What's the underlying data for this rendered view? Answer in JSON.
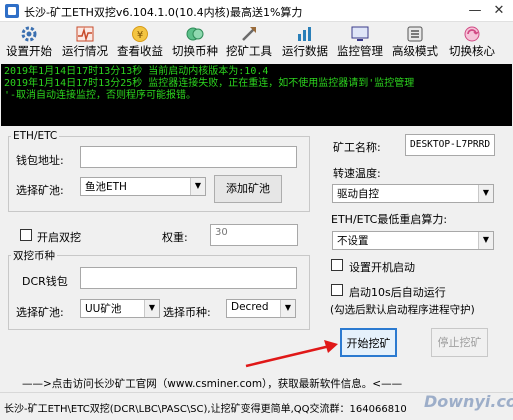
{
  "window": {
    "title": "长沙-矿工ETH双挖v6.104.1.0(10.4内核)最高送1%算力",
    "minimize_icon": "minimize-icon",
    "close_icon": "close-icon"
  },
  "toolbar": [
    {
      "label": "设置开始",
      "icon": "gear-icon",
      "color": "#3a6fb0"
    },
    {
      "label": "运行情况",
      "icon": "activity-icon",
      "color": "#c84a2a"
    },
    {
      "label": "查看收益",
      "icon": "money-icon",
      "color": "#d69a16"
    },
    {
      "label": "切换币种",
      "icon": "coin-icon",
      "color": "#2e8b57"
    },
    {
      "label": "挖矿工具",
      "icon": "tools-icon",
      "color": "#6b6b6b"
    },
    {
      "label": "运行数据",
      "icon": "data-icon",
      "color": "#2a7fb8"
    },
    {
      "label": "监控管理",
      "icon": "monitor-icon",
      "color": "#3a3a8a"
    },
    {
      "label": "高级模式",
      "icon": "advanced-icon",
      "color": "#555555"
    },
    {
      "label": "切换核心",
      "icon": "core-icon",
      "color": "#d14a84"
    }
  ],
  "console": {
    "lines": [
      "2019年1月14日17时13分13秒 当前启动内核版本为:10.4",
      "2019年1月14日17时13分25秒 监控器连接失败，正在重连，如不使用监控器请到'监控管理",
      "'-取消自动连接监控，否则程序可能报错。"
    ]
  },
  "eth_group": {
    "legend": "ETH/ETC",
    "wallet_label": "钱包地址:",
    "wallet_value": "",
    "pool_label": "选择矿池:",
    "pool_value": "鱼池ETH",
    "add_pool_button": "添加矿池"
  },
  "dual": {
    "enable_label": "开启双挖",
    "weight_label": "权重:",
    "weight_value": "30"
  },
  "dual_group": {
    "legend": "双挖币种",
    "dcr_label": "DCR钱包",
    "dcr_value": "",
    "pool_label": "选择矿池:",
    "pool_value": "UU矿池",
    "coin_label": "选择币种:",
    "coin_value": "Decred"
  },
  "right_panel": {
    "miner_name_label": "矿工名称:",
    "miner_name_value": "DESKTOP-L7PRRD",
    "temp_label": "转速温度:",
    "temp_value": "驱动自控",
    "min_hashrate_label": "ETH/ETC最低重启算力:",
    "min_hashrate_value": "不设置",
    "autostart_label": "设置开机启动",
    "autorun_label": "启动10s后自动运行",
    "autorun_note": "(勾选后默认启动程序进程守护)"
  },
  "buttons": {
    "start": "开始挖矿",
    "stop": "停止挖矿"
  },
  "footer": {
    "link_text": "——>点击访问长沙矿工官网（www.csminer.com），获取最新软件信息。<——",
    "status_text": "长沙-矿工ETH\\ETC双挖(DCR\\LBC\\PASC\\SC),让挖矿变得更简单,QQ交流群：164066810",
    "watermark": "Downyi.com"
  },
  "colors": {
    "arrow": "#e01818",
    "console_text": "#2cd51e",
    "console_bg": "#000000",
    "start_button_border": "#2b7ad0"
  }
}
